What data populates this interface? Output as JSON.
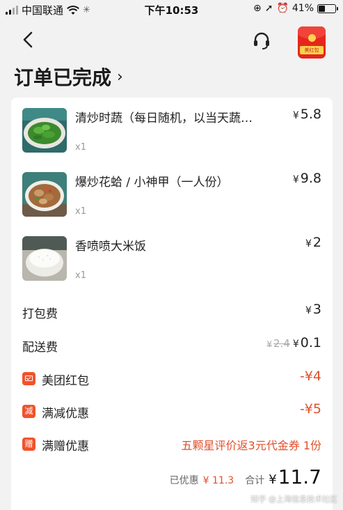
{
  "status_bar": {
    "carrier": "中国联通",
    "time": "下午10:53",
    "battery": "41%",
    "battery_level": 0.41
  },
  "nav": {
    "redpack_tag": "美红包"
  },
  "page": {
    "title": "订单已完成",
    "title_chevron": "›"
  },
  "items": [
    {
      "name": "清炒时蔬（每日随机，以当天蔬…",
      "qty": "x1",
      "currency": "¥",
      "price": "5.8",
      "image": "green-vegetables"
    },
    {
      "name": "爆炒花蛤 / 小神甲（一人份）",
      "qty": "x1",
      "currency": "¥",
      "price": "9.8",
      "image": "stir-fried-clams"
    },
    {
      "name": "香喷喷大米饭",
      "qty": "x1",
      "currency": "¥",
      "price": "2",
      "image": "rice-bowl"
    }
  ],
  "fees": {
    "packing_label": "打包费",
    "packing_value": "3",
    "delivery_label": "配送费",
    "delivery_original": "2.4",
    "delivery_value": "0.1"
  },
  "discounts": {
    "redpack_label": "美团红包",
    "redpack_value": "-¥4",
    "reduce_badge": "减",
    "reduce_label": "满减优惠",
    "reduce_value": "-¥5",
    "gift_badge": "赠",
    "gift_label": "满赠优惠",
    "gift_text": "五颗星评价返3元代金券 1份"
  },
  "summary": {
    "discount_label": "已优惠",
    "discount_value": "¥ 11.3",
    "total_label": "合计",
    "total_currency": "¥",
    "total_value": "11.7"
  },
  "watermark": "知乎 @上海信息技术社区",
  "colors": {
    "accent": "#e0502c",
    "brand_red": "#e5261d"
  }
}
